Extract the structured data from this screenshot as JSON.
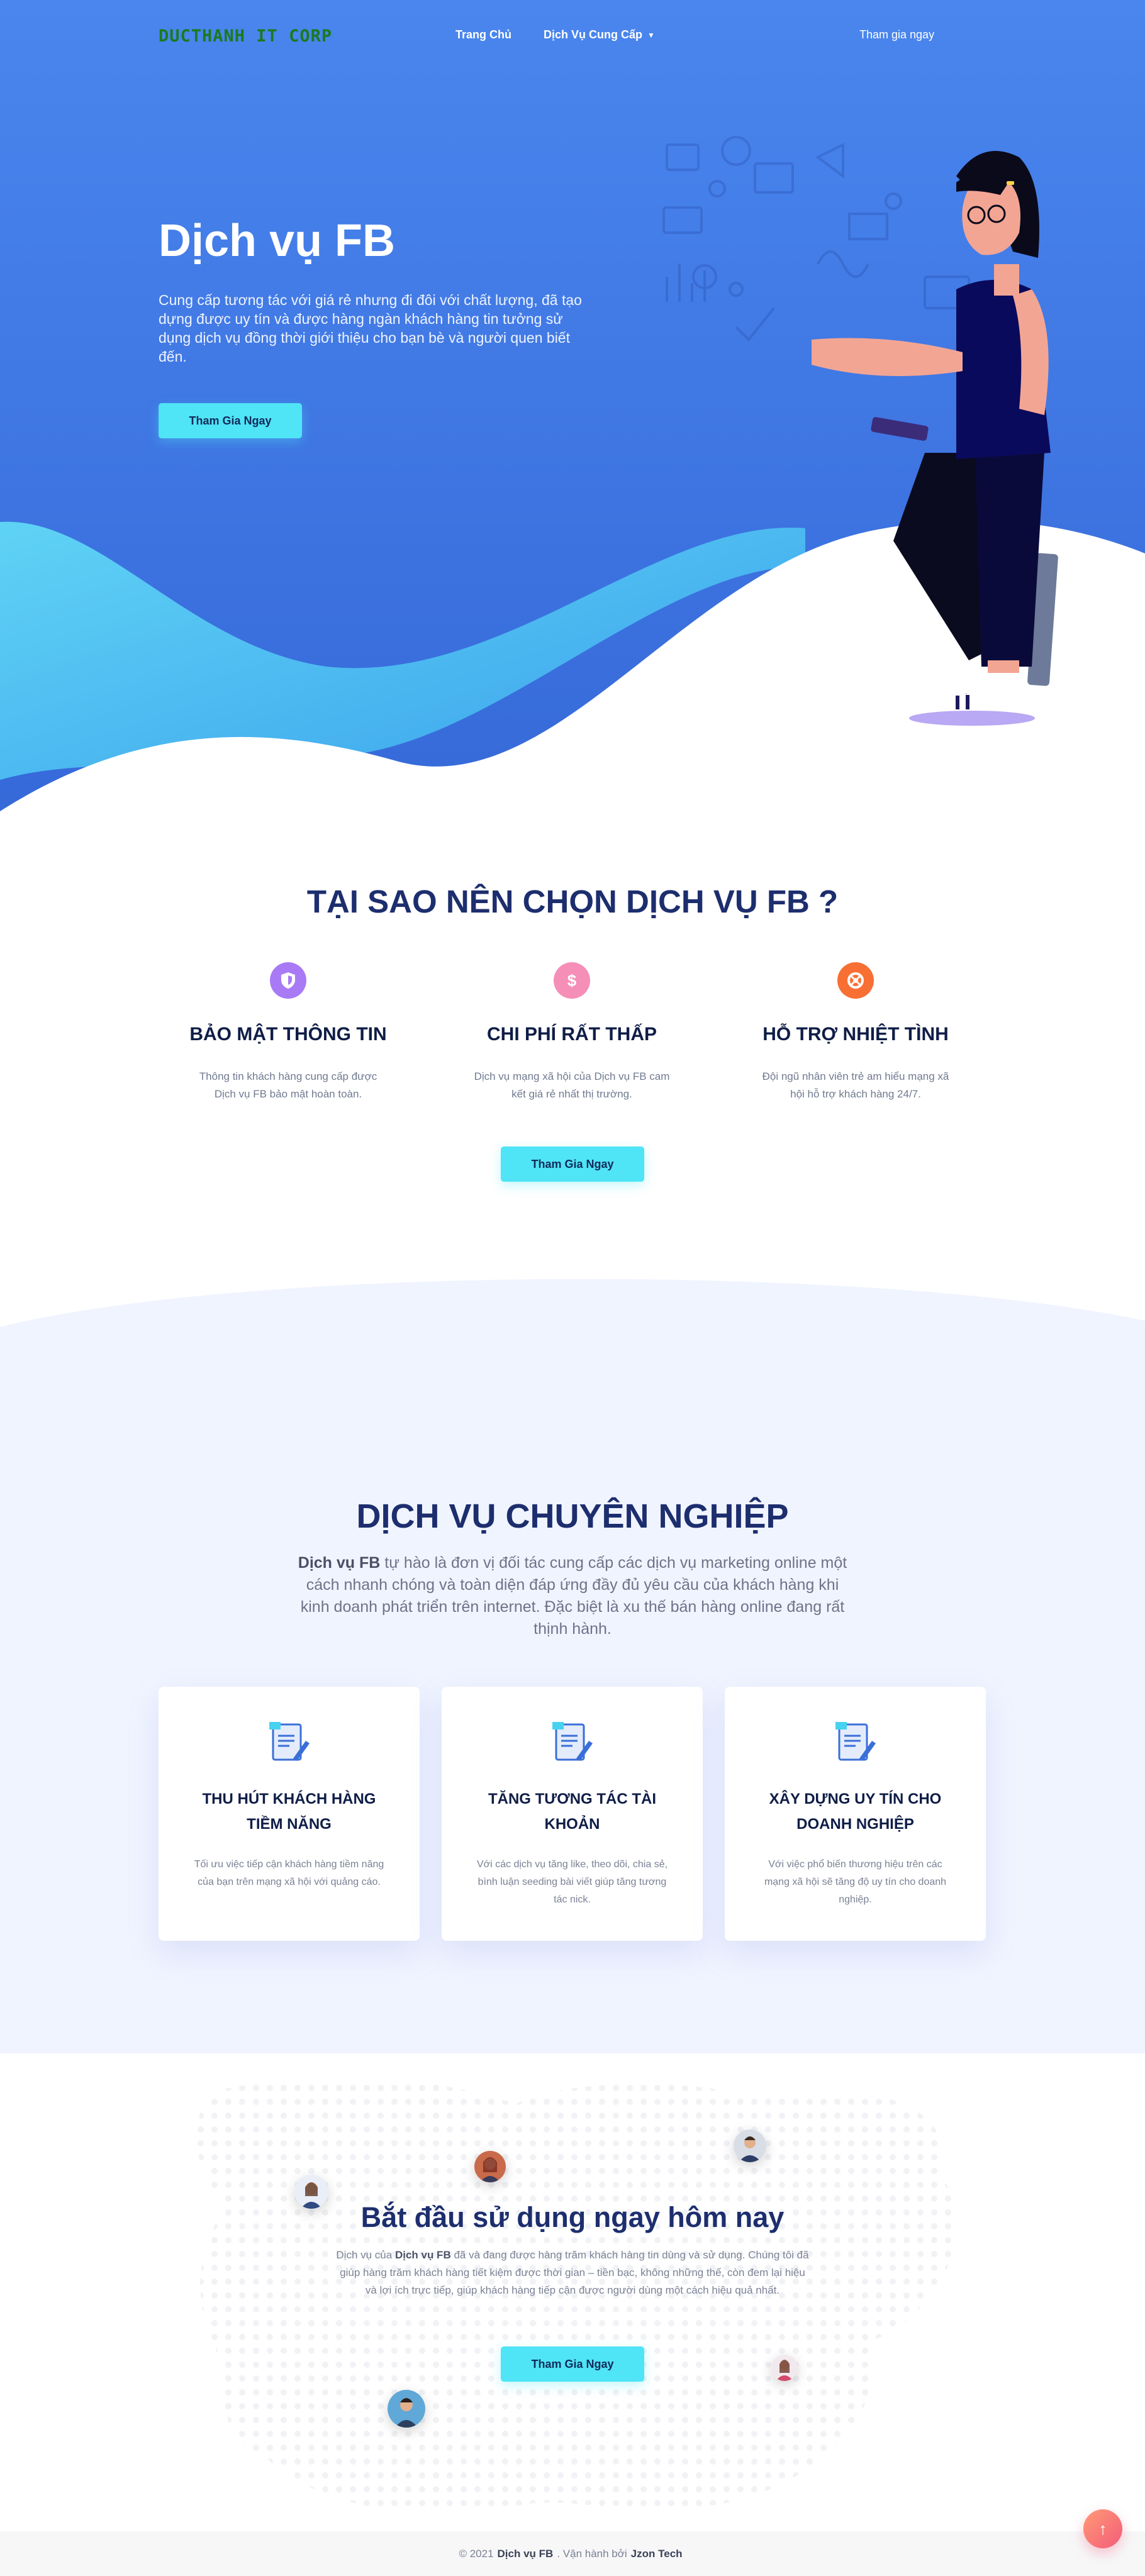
{
  "nav": {
    "logo": "DUCTHANH IT CORP",
    "home": "Trang Chủ",
    "services": "Dịch Vụ Cung Cấp",
    "join": "Tham gia ngay"
  },
  "hero": {
    "title": "Dịch vụ FB",
    "description": "Cung cấp tương tác với giá rẻ nhưng đi đôi với chất lượng, đã tạo dựng được uy tín và được hàng ngàn khách hàng tin tưởng sử dụng dịch vụ đồng thời giới thiệu cho bạn bè và người quen biết đến.",
    "button": "Tham Gia Ngay"
  },
  "why": {
    "title": "TẠI SAO NÊN CHỌN DỊCH VỤ FB ?",
    "button": "Tham Gia Ngay",
    "features": [
      {
        "icon": "shield-icon",
        "icon_color": "#a97af5",
        "title": "BẢO MẬT THÔNG TIN",
        "text": "Thông tin khách hàng cung cấp được Dịch vụ FB bảo mật hoàn toàn."
      },
      {
        "icon": "dollar-icon",
        "icon_color": "#f58fb8",
        "title": "CHI PHÍ RẤT THẤP",
        "text": "Dịch vụ mạng xã hội của Dịch vụ FB cam kết giá rẻ nhất thị trường."
      },
      {
        "icon": "support-icon",
        "icon_color": "#f86f34",
        "title": "HỖ TRỢ NHIỆT TÌNH",
        "text": "Đội ngũ nhân viên trẻ am hiểu mạng xã hội hỗ trợ khách hàng 24/7."
      }
    ]
  },
  "services": {
    "title": "DỊCH VỤ CHUYÊN NGHIỆP",
    "desc_bold": "Dịch vụ FB",
    "desc_rest": " tự hào là đơn vị đối tác cung cấp các dịch vụ marketing online một cách nhanh chóng và toàn diện đáp ứng đầy đủ yêu cầu của khách hàng khi kinh doanh phát triển trên internet. Đặc biệt là xu thế bán hàng online đang rất thịnh hành.",
    "cards": [
      {
        "icon": "document-icon",
        "title": "THU HÚT KHÁCH HÀNG TIỀM NĂNG",
        "text": "Tối ưu việc tiếp cận khách hàng tiềm năng của bạn trên mạng xã hội với quảng cáo."
      },
      {
        "icon": "document-icon",
        "title": "TĂNG TƯƠNG TÁC TÀI KHOẢN",
        "text": "Với các dịch vụ tăng like, theo dõi, chia sẻ, bình luận seeding bài viết giúp tăng tương tác nick."
      },
      {
        "icon": "document-icon",
        "title": "XÂY DỰNG UY TÍN CHO DOANH NGHIỆP",
        "text": "Với việc phổ biến thương hiệu trên các mạng xã hội sẽ tăng độ uy tín cho doanh nghiệp."
      }
    ]
  },
  "start": {
    "title": "Bắt đầu sử dụng ngay hôm nay",
    "desc_prefix": "Dịch vụ của ",
    "desc_bold": "Dịch vụ FB",
    "desc_rest": " đã và đang được hàng trăm khách hàng tin dùng và sử dụng. Chúng tôi đã giúp hàng trăm khách hàng tiết kiệm được thời gian – tiền bạc, không những thế, còn đem lại hiệu và lợi ích trực tiếp, giúp khách hàng tiếp cận được người dùng một cách hiệu quả nhất.",
    "button": "Tham Gia Ngay"
  },
  "footer": {
    "prefix": "© 2021",
    "brand": "Dịch vụ FB",
    "middle": ". Vận hành bởi",
    "operator": "Jzon Tech"
  },
  "colors": {
    "hero_blue": "#4a86ee",
    "accent_cyan": "#4fe4f6",
    "heading_navy": "#1d2e6e"
  }
}
